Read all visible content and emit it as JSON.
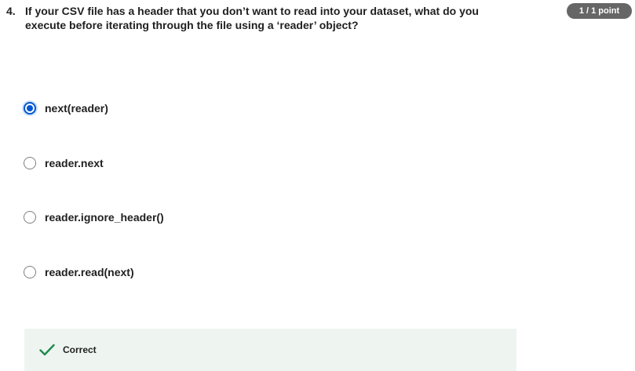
{
  "question": {
    "number": "4.",
    "text": "If your CSV file has a header that you don’t want to read into your dataset, what do you execute before iterating through the file using a ‘reader’ object?",
    "points": "1 / 1 point"
  },
  "options": [
    {
      "label": "next(reader)",
      "selected": true
    },
    {
      "label": "reader.next",
      "selected": false
    },
    {
      "label": "reader.ignore_header()",
      "selected": false
    },
    {
      "label": "reader.read(next)",
      "selected": false
    }
  ],
  "feedback": {
    "status": "Correct",
    "icon": "checkmark-icon"
  },
  "colors": {
    "accent": "#0056d2",
    "success": "#1e8a4c",
    "feedback_bg": "#eef5f1",
    "badge_bg": "#666666"
  }
}
